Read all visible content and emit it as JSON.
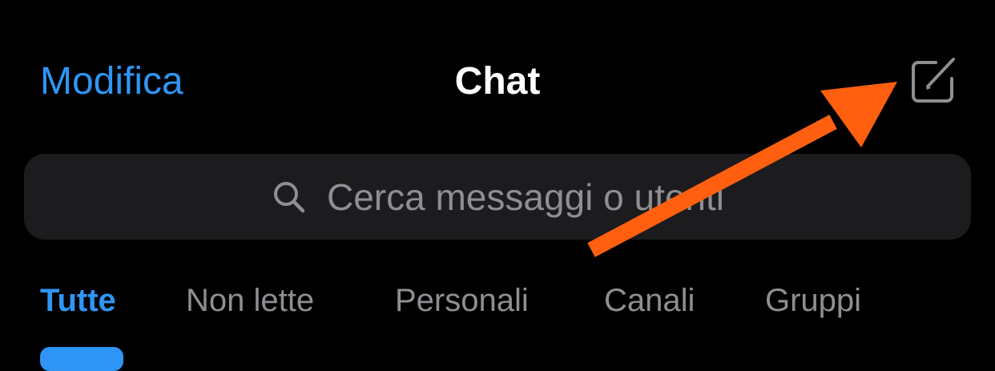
{
  "header": {
    "edit_label": "Modifica",
    "title": "Chat",
    "compose_icon": "compose-icon"
  },
  "search": {
    "placeholder": "Cerca messaggi o utenti",
    "icon": "search-icon"
  },
  "tabs": [
    {
      "label": "Tutte",
      "active": true
    },
    {
      "label": "Non lette",
      "active": false
    },
    {
      "label": "Personali",
      "active": false
    },
    {
      "label": "Canali",
      "active": false
    },
    {
      "label": "Gruppi",
      "active": false
    }
  ],
  "colors": {
    "accent": "#2f95f5",
    "background": "#000000",
    "search_background": "#1c1c1e",
    "secondary_text": "#8e8e93",
    "annotation_arrow": "#ff5f0f"
  }
}
